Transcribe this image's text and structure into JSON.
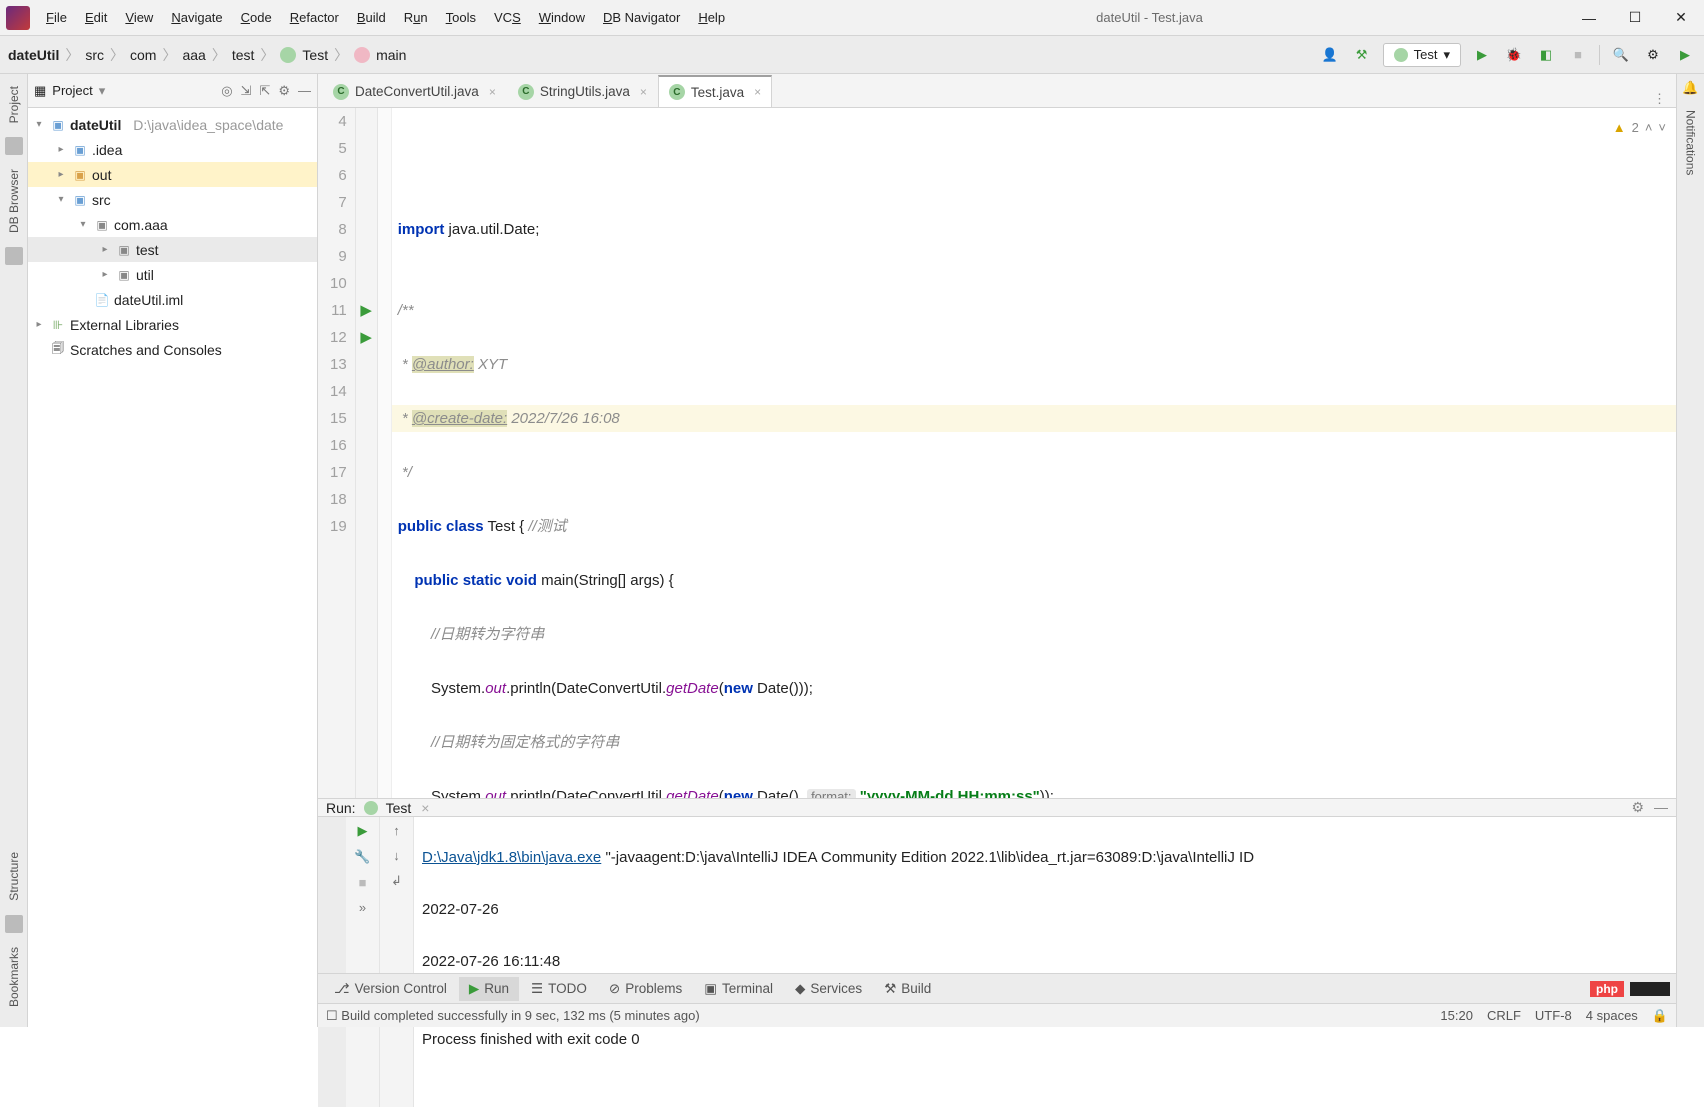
{
  "window": {
    "title": "dateUtil - Test.java"
  },
  "menu": [
    "File",
    "Edit",
    "View",
    "Navigate",
    "Code",
    "Refactor",
    "Build",
    "Run",
    "Tools",
    "VCS",
    "Window",
    "DB Navigator",
    "Help"
  ],
  "breadcrumbs": [
    "dateUtil",
    "src",
    "com",
    "aaa",
    "test",
    "Test",
    "main"
  ],
  "runConfig": "Test",
  "leftRail": {
    "project": "Project",
    "dbbrowser": "DB Browser",
    "structure": "Structure",
    "bookmarks": "Bookmarks"
  },
  "rightRail": {
    "notifications": "Notifications"
  },
  "projectPane": {
    "title": "Project",
    "rootName": "dateUtil",
    "rootPath": "D:\\java\\idea_space\\date",
    "nodes": {
      "idea": ".idea",
      "out": "out",
      "src": "src",
      "pkg": "com.aaa",
      "test": "test",
      "util": "util",
      "iml": "dateUtil.iml",
      "extlib": "External Libraries",
      "scratch": "Scratches and Consoles"
    }
  },
  "tabs": [
    {
      "name": "DateConvertUtil.java",
      "active": false
    },
    {
      "name": "StringUtils.java",
      "active": false
    },
    {
      "name": "Test.java",
      "active": true
    }
  ],
  "editor": {
    "warnings": "2",
    "gutter": [
      "4",
      "5",
      "6",
      "7",
      "8",
      "9",
      "10",
      "11",
      "12",
      "13",
      "14",
      "15",
      "16",
      "17",
      "18",
      "19"
    ],
    "runLines": [
      11,
      12
    ],
    "highlightIndex": 11,
    "code": {
      "l4": "",
      "l5_import": "import",
      "l5_rest": " java.util.Date;",
      "l6": "",
      "l7": "/**",
      "l8_pre": " * ",
      "l8_tag": "@author:",
      "l8_post": " XYT",
      "l9_pre": " * ",
      "l9_tag": "@create-date:",
      "l9_post": " 2022/7/26 16:08",
      "l10": " */",
      "l11_public": "public",
      "l11_class": "class",
      "l11_name": " Test { ",
      "l11_com": "//测试",
      "l12_pre": "    ",
      "l12_public": "public",
      "l12_static": "static",
      "l12_void": "void",
      "l12_sig": " main(String[] args) {",
      "l13_pre": "        ",
      "l13_com": "//日期转为字符串",
      "l14_pre": "        System.",
      "l14_out": "out",
      "l14_mid": ".println(DateConvertUtil.",
      "l14_get": "getDate",
      "l14_open": "(",
      "l14_new": "new",
      "l14_end": " Date()));",
      "l15_pre": "        ",
      "l15_com": "//日期转为固定格式的字符串",
      "l16_pre": "        System.",
      "l16_out": "out",
      "l16_mid": ".println(DateConvertUtil.",
      "l16_get": "getDate",
      "l16_open": "(",
      "l16_new": "new",
      "l16_d": " Date(), ",
      "l16_hint": "format:",
      "l16_sp": " ",
      "l16_str": "\"yyyy-MM-dd HH:mm:ss\"",
      "l16_end": "));",
      "l17": "    }",
      "l18": "}",
      "l19": ""
    }
  },
  "run": {
    "label": "Run:",
    "tab": "Test",
    "line1_link": "D:\\Java\\jdk1.8\\bin\\java.exe",
    "line1_rest": " \"-javaagent:D:\\java\\IntelliJ IDEA Community Edition 2022.1\\lib\\idea_rt.jar=63089:D:\\java\\IntelliJ ID",
    "line2": "2022-07-26",
    "line3": "2022-07-26 16:11:48",
    "line4": "",
    "line5": "Process finished with exit code 0"
  },
  "bottomTabs": {
    "vcs": "Version Control",
    "run": "Run",
    "todo": "TODO",
    "problems": "Problems",
    "terminal": "Terminal",
    "services": "Services",
    "build": "Build",
    "php": "php"
  },
  "status": {
    "msg": "Build completed successfully in 9 sec, 132 ms (5 minutes ago)",
    "pos": "15:20",
    "eol": "CRLF",
    "enc": "UTF-8",
    "indent": "4 spaces"
  }
}
